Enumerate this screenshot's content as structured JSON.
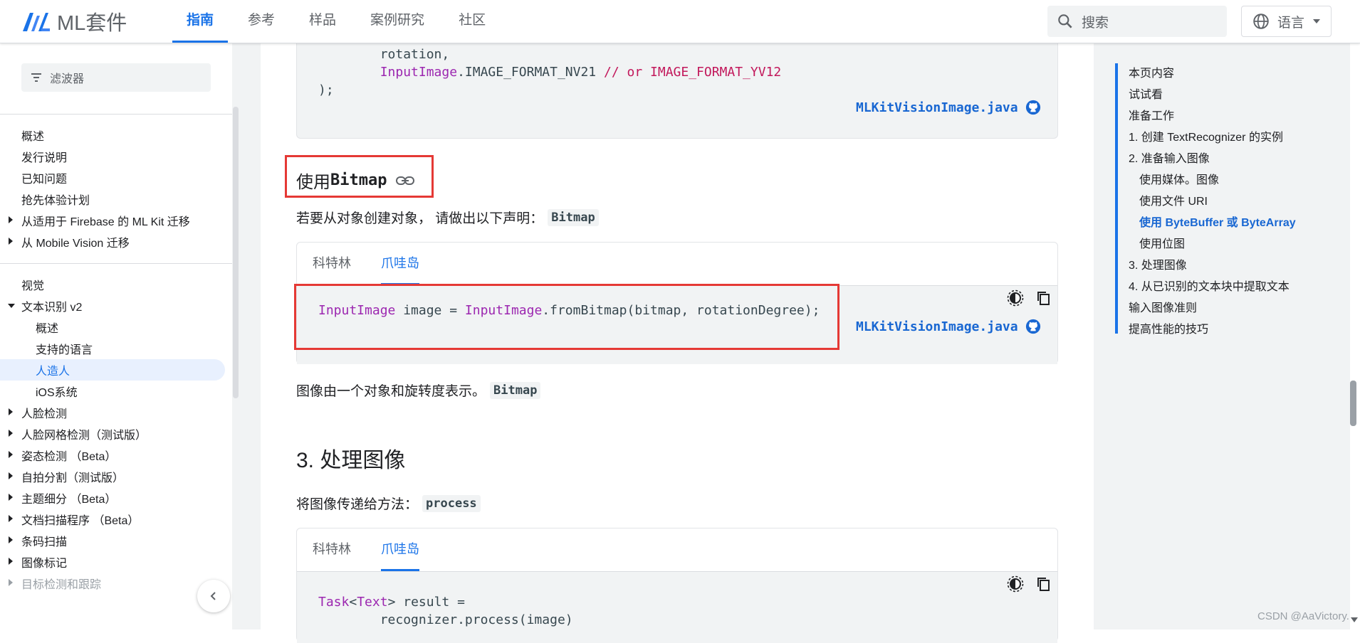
{
  "header": {
    "logo_text": "ML套件",
    "nav": [
      {
        "label": "指南",
        "active": true
      },
      {
        "label": "参考",
        "active": false
      },
      {
        "label": "样品",
        "active": false
      },
      {
        "label": "案例研究",
        "active": false
      },
      {
        "label": "社区",
        "active": false
      }
    ],
    "search_placeholder": "搜索",
    "language_label": "语言"
  },
  "leftnav": {
    "filter_placeholder": "滤波器",
    "group1": [
      "概述",
      "发行说明",
      "已知问题",
      "抢先体验计划",
      "从适用于 Firebase 的 ML Kit 迁移",
      "从 Mobile Vision 迁移"
    ],
    "section_title": "视觉",
    "text_recognition": "文本识别 v2",
    "text_recognition_children": [
      "概述",
      "支持的语言",
      "人造人",
      "iOS系统"
    ],
    "group2": [
      "人脸检测",
      "人脸网格检测（测试版）",
      "姿态检测 （Beta）",
      "自拍分割（测试版）",
      "主题细分 （Beta）",
      "文档扫描程序 （Beta）",
      "条码扫描",
      "图像标记",
      "目标检测和跟踪"
    ]
  },
  "content": {
    "code1_lines": [
      "        rotation,",
      "        InputImage",
      ".IMAGE_FORMAT_NV21 ",
      "// or ",
      "IMAGE_FORMAT_YV12",
      ");"
    ],
    "code1_source": "MLKitVisionImage.java",
    "h2_prefix": "使用",
    "h2_code": "Bitmap",
    "para1_text": "若要从对象创建对象， 请做出以下声明：",
    "para1_code": "Bitmap",
    "tabs": [
      "科特林",
      "爪哇岛"
    ],
    "code2_kw1": "InputImage",
    "code2_mid": " image = ",
    "code2_kw2": "InputImage",
    "code2_rest": ".fromBitmap(bitmap, rotationDegree);",
    "code2_source": "MLKitVisionImage.java",
    "para2_text": "图像由一个对象和旋转度表示。",
    "para2_code": "Bitmap",
    "h1": "3. 处理图像",
    "para3_text": "将图像传递给方法：",
    "para3_code": "process",
    "code3_kw1": "Task",
    "code3_lt": "<",
    "code3_kw2": "Text",
    "code3_rest": "> result =",
    "code3_line2": "        recognizer.process(image)"
  },
  "toc": {
    "title": "本页内容",
    "items": [
      {
        "label": "试试看",
        "level": 1,
        "active": false
      },
      {
        "label": "准备工作",
        "level": 1,
        "active": false
      },
      {
        "label": "1. 创建 TextRecognizer 的实例",
        "level": 1,
        "active": false
      },
      {
        "label": "2. 准备输入图像",
        "level": 1,
        "active": false
      },
      {
        "label": "使用媒体。图像",
        "level": 2,
        "active": false
      },
      {
        "label": "使用文件 URI",
        "level": 2,
        "active": false
      },
      {
        "label": "使用 ByteBuffer 或 ByteArray",
        "level": 2,
        "active": true
      },
      {
        "label": "使用位图",
        "level": 2,
        "active": false
      },
      {
        "label": "3. 处理图像",
        "level": 1,
        "active": false
      },
      {
        "label": "4. 从已识别的文本块中提取文本",
        "level": 1,
        "active": false
      },
      {
        "label": "输入图像准则",
        "level": 1,
        "active": false
      },
      {
        "label": "提高性能的技巧",
        "level": 1,
        "active": false
      }
    ]
  },
  "watermark": "CSDN @AaVictory.",
  "colors": {
    "accent": "#1a73e8",
    "highlight": "#e53935",
    "keyword": "#9c27b0",
    "comment": "#c2185b"
  }
}
